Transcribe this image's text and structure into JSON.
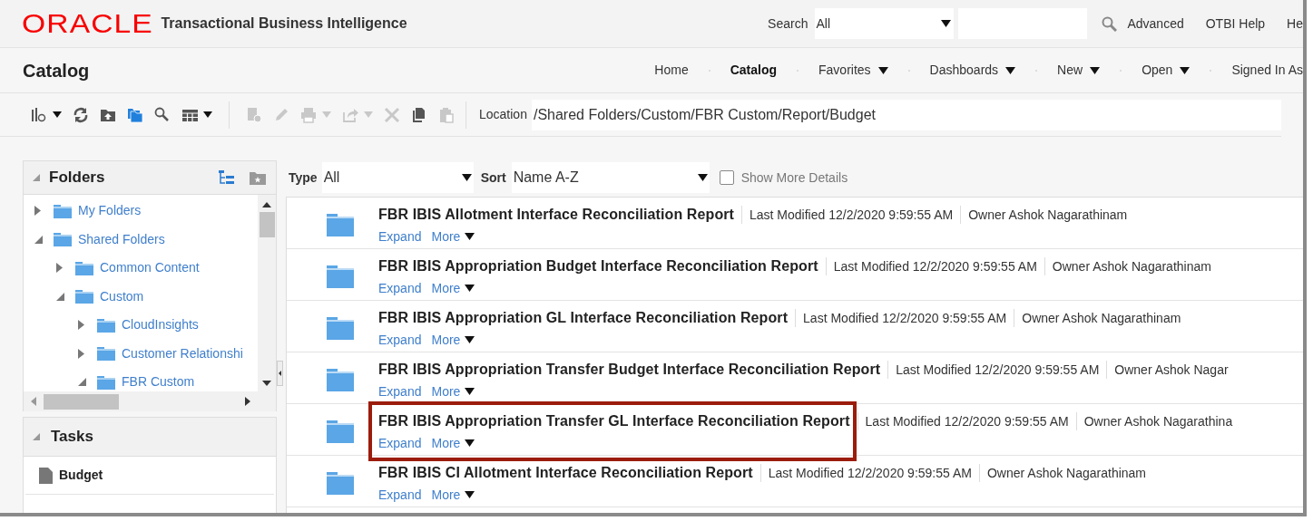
{
  "header": {
    "logo": "ORACLE",
    "product": "Transactional Business Intelligence",
    "search_label": "Search",
    "search_scope": "All",
    "links": [
      "Advanced",
      "OTBI Help",
      "He"
    ]
  },
  "page_title": "Catalog",
  "nav": [
    {
      "label": "Home",
      "selected": false,
      "dropdown": false
    },
    {
      "label": "Catalog",
      "selected": true,
      "dropdown": false
    },
    {
      "label": "Favorites",
      "selected": false,
      "dropdown": true
    },
    {
      "label": "Dashboards",
      "selected": false,
      "dropdown": true
    },
    {
      "label": "New",
      "selected": false,
      "dropdown": true
    },
    {
      "label": "Open",
      "selected": false,
      "dropdown": true
    },
    {
      "label": "Signed In As",
      "selected": false,
      "dropdown": false
    }
  ],
  "toolbar": {
    "buttons": [
      {
        "kind": "view",
        "disabled": false,
        "dropdown": true
      },
      {
        "kind": "refresh",
        "disabled": false,
        "dropdown": false
      },
      {
        "kind": "upload",
        "disabled": false,
        "dropdown": false
      },
      {
        "kind": "folders",
        "disabled": false,
        "dropdown": false
      },
      {
        "kind": "search",
        "disabled": false,
        "dropdown": false
      },
      {
        "kind": "grid",
        "disabled": false,
        "dropdown": true
      },
      {
        "kind": "properties",
        "disabled": true,
        "dropdown": false
      },
      {
        "kind": "edit",
        "disabled": true,
        "dropdown": false
      },
      {
        "kind": "print",
        "disabled": true,
        "dropdown": true
      },
      {
        "kind": "export",
        "disabled": true,
        "dropdown": true
      },
      {
        "kind": "delete",
        "disabled": true,
        "dropdown": false
      },
      {
        "kind": "copy",
        "disabled": false,
        "dropdown": false
      },
      {
        "kind": "paste",
        "disabled": true,
        "dropdown": false
      }
    ],
    "location_label": "Location",
    "location": "/Shared Folders/Custom/FBR Custom/Report/Budget"
  },
  "folders_panel": {
    "title": "Folders",
    "expanded": true,
    "tree": [
      {
        "label": "My Folders",
        "expanded": false
      },
      {
        "label": "Shared Folders",
        "expanded": true,
        "children": [
          {
            "label": "Common Content",
            "expanded": false
          },
          {
            "label": "Custom",
            "expanded": true,
            "children": [
              {
                "label": "CloudInsights",
                "expanded": false
              },
              {
                "label": "Customer Relationshi",
                "expanded": false
              },
              {
                "label": "FBR Custom",
                "expanded": true
              }
            ]
          }
        ]
      }
    ]
  },
  "tasks_panel": {
    "title": "Tasks",
    "expanded": true,
    "items": [
      {
        "label": "Budget"
      }
    ]
  },
  "filters": {
    "type_label": "Type",
    "type": "All",
    "sort_label": "Sort",
    "sort": "Name A-Z",
    "show_more_details": {
      "label": "Show More Details",
      "checked": false
    }
  },
  "items": [
    {
      "name": "FBR IBIS Allotment Interface Reconciliation Report",
      "modified": "Last Modified 12/2/2020 9:59:55 AM",
      "owner": "Owner Ashok Nagarathinam",
      "expand": "Expand",
      "more": "More",
      "highlighted": false
    },
    {
      "name": "FBR IBIS Appropriation Budget Interface Reconciliation Report",
      "modified": "Last Modified 12/2/2020 9:59:55 AM",
      "owner": "Owner Ashok Nagarathinam",
      "expand": "Expand",
      "more": "More",
      "highlighted": false
    },
    {
      "name": "FBR IBIS Appropriation GL Interface Reconciliation Report",
      "modified": "Last Modified 12/2/2020 9:59:55 AM",
      "owner": "Owner Ashok Nagarathinam",
      "expand": "Expand",
      "more": "More",
      "highlighted": false
    },
    {
      "name": "FBR IBIS Appropriation Transfer Budget Interface Reconciliation Report",
      "modified": "Last Modified 12/2/2020 9:59:55 AM",
      "owner": "Owner Ashok Nagar",
      "expand": "Expand",
      "more": "More",
      "highlighted": false
    },
    {
      "name": "FBR IBIS Appropriation Transfer GL Interface Reconciliation Report",
      "modified": "Last Modified 12/2/2020 9:59:55 AM",
      "owner": "Owner Ashok Nagarathina",
      "expand": "Expand",
      "more": "More",
      "highlighted": true
    },
    {
      "name": "FBR IBIS CI Allotment Interface Reconciliation Report",
      "modified": "Last Modified 12/2/2020 9:59:55 AM",
      "owner": "Owner Ashok Nagarathinam",
      "expand": "Expand",
      "more": "More",
      "highlighted": false
    }
  ]
}
